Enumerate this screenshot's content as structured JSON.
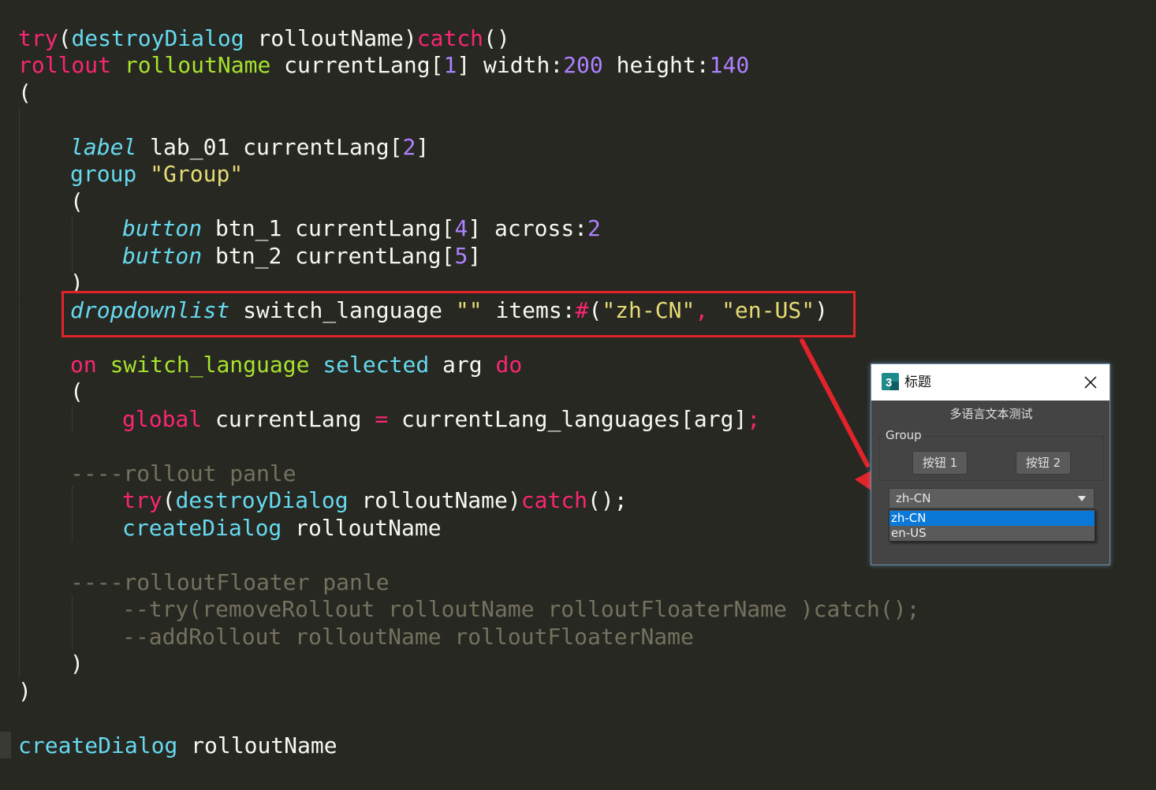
{
  "code": {
    "line1": [
      "try",
      "(",
      "destroyDialog",
      " rolloutName)",
      "catch",
      "()"
    ],
    "line2": [
      "rollout",
      " ",
      "rolloutName",
      " currentLang[",
      "1",
      "] width:",
      "200",
      " height:",
      "140"
    ],
    "line3": "(",
    "line4": [
      "label",
      " lab_01 currentLang[",
      "2",
      "]"
    ],
    "line5": [
      "group",
      " ",
      "\"Group\""
    ],
    "line6": "(",
    "line7": [
      "button",
      " btn_1 currentLang[",
      "4",
      "] across:",
      "2"
    ],
    "line8": [
      "button",
      " btn_2 currentLang[",
      "5",
      "]"
    ],
    "line9": ")",
    "line10": [
      "dropdownlist",
      " switch_language ",
      "\"\"",
      " items:",
      "#",
      "(",
      "\"zh-CN\"",
      ", ",
      "\"en-US\"",
      ")"
    ],
    "line11": [
      "on",
      " ",
      "switch_language",
      " ",
      "selected",
      " arg ",
      "do"
    ],
    "line12": "(",
    "line13": [
      "global",
      " currentLang ",
      "=",
      " currentLang_languages[arg]",
      ";"
    ],
    "line14": "----rollout panle",
    "line15": [
      "try",
      "(",
      "destroyDialog",
      " rolloutName)",
      "catch",
      "();"
    ],
    "line16": [
      "createDialog",
      " rolloutName"
    ],
    "line17": "----rolloutFloater panle",
    "line18": "--try(removeRollout rolloutName rolloutFloaterName )catch();",
    "line19": "--addRollout rolloutName rolloutFloaterName",
    "line20": ")",
    "line21": ")",
    "line22": [
      "createDialog",
      " rolloutName"
    ]
  },
  "dialog": {
    "title": "标题",
    "app_icon_text": "3",
    "label_text": "多语言文本测试",
    "group_title": "Group",
    "button1": "按钮 1",
    "button2": "按钮 2",
    "dropdown_value": "zh-CN",
    "options": [
      "zh-CN",
      "en-US"
    ],
    "selected_option": "zh-CN"
  },
  "colors": {
    "background": "#272822",
    "keyword": "#F92672",
    "function": "#66D9EF",
    "name": "#A6E22E",
    "number": "#AE81FF",
    "string": "#E6DB74",
    "comment": "#75715E",
    "text": "#F8F8F2",
    "highlight_box": "#E0242A",
    "arrow": "#E0242A",
    "selection": "#0A78D7"
  },
  "icons": {
    "app": "3ds-max-app-icon",
    "close": "close-icon",
    "dropdown": "dropdown-arrow-icon",
    "annotation": "red-arrow-icon"
  }
}
